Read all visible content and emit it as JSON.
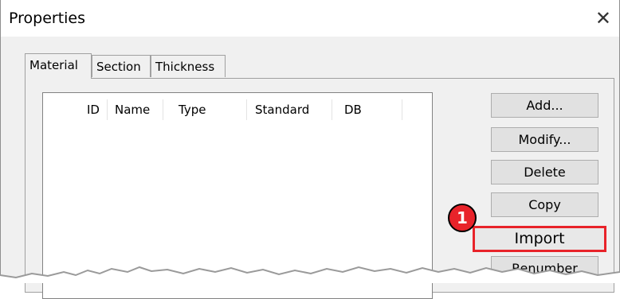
{
  "window": {
    "title": "Properties",
    "close_glyph": "✕"
  },
  "tabs": [
    {
      "label": "Material",
      "active": true
    },
    {
      "label": "Section",
      "active": false
    },
    {
      "label": "Thickness",
      "active": false
    }
  ],
  "list": {
    "columns": [
      "ID",
      "Name",
      "Type",
      "Standard",
      "DB"
    ],
    "rows": []
  },
  "buttons": {
    "add": "Add...",
    "modify": "Modify...",
    "delete": "Delete",
    "copy": "Copy",
    "import": "Import",
    "renumber": "Renumber"
  },
  "callout": {
    "number": "1"
  },
  "colors": {
    "highlight": "#e8232a",
    "panel": "#f0f0f0"
  },
  "icons": {
    "close": "close-icon"
  }
}
